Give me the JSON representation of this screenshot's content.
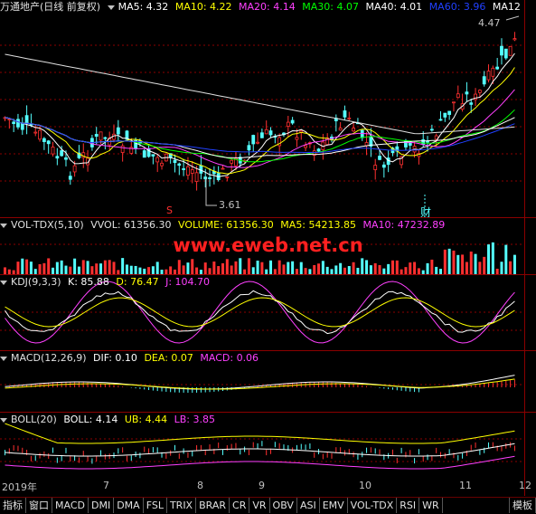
{
  "main_header": {
    "stock_name": "万通地产",
    "mode": "(日线 前复权)",
    "ma5": "MA5: 4.32",
    "ma10": "MA10: 4.22",
    "ma20": "MA20: 4.14",
    "ma30": "MA30: 4.07",
    "ma40": "MA40: 4.01",
    "ma60": "MA60: 3.96",
    "ma120": "MA12"
  },
  "main_chart": {
    "high_label": "4.47",
    "low_label": "3.61",
    "marker_s": "S",
    "marker_cai": "财"
  },
  "vol_header": {
    "name": "VOL-TDX(5,10)",
    "vvol": "VVOL: 61356.30",
    "volume": "VOLUME: 61356.30",
    "ma5": "MA5: 54213.85",
    "ma10": "MA10: 47232.89"
  },
  "watermark": "www.eweb.net.cn",
  "kdj_header": {
    "name": "KDJ(9,3,3)",
    "k": "K: 85.88",
    "d": "D: 76.47",
    "j": "J: 104.70"
  },
  "macd_header": {
    "name": "MACD(12,26,9)",
    "dif": "DIF: 0.10",
    "dea": "DEA: 0.07",
    "macd": "MACD: 0.06"
  },
  "boll_header": {
    "name": "BOLL(20)",
    "boll": "BOLL: 4.14",
    "ub": "UB: 4.44",
    "lb": "LB: 3.85"
  },
  "date_axis": [
    "2019年",
    "7",
    "8",
    "9",
    "10",
    "11",
    "12"
  ],
  "bottom_tabs": [
    "指标",
    "窗口",
    "MACD",
    "DMI",
    "DMA",
    "FSL",
    "TRIX",
    "BRAR",
    "CR",
    "VR",
    "OBV",
    "ASI",
    "EMV",
    "VOL-TDX",
    "RSI",
    "WR",
    "模板"
  ],
  "colors": {
    "up": "#ff3030",
    "down": "#54ffff",
    "ma5": "#ffffff",
    "ma10": "#ffff00",
    "ma20": "#ff40ff",
    "ma30": "#00ff00",
    "ma40": "#ffffff",
    "ma60": "#2040ff",
    "grid": "#8b0000"
  }
}
